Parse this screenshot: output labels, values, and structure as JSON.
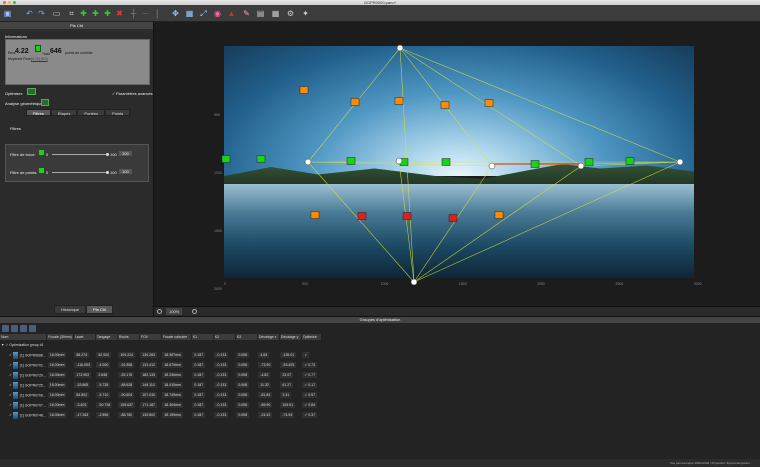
{
  "window": {
    "title": "GOPR0000.pano*"
  },
  "toolbar": {
    "icons": [
      "new-icon",
      "undo-icon",
      "redo-icon",
      "image-icon",
      "crop-icon",
      "control-points-icon",
      "add-points-icon",
      "remove-points-icon",
      "delete-icon",
      "lines-icon",
      "horizon-icon",
      "vertical-icon",
      "move-icon",
      "layout-icon",
      "fit-icon",
      "color-icon",
      "mask-icon",
      "blend-icon",
      "output-icon",
      "grid-icon",
      "settings-icon",
      "tools-icon"
    ]
  },
  "left_panel": {
    "title": "Pts Ctrl",
    "information_label": "Informations",
    "info": {
      "rms_label": "Rms:",
      "rms_value": "4.22",
      "points_count": "646",
      "points_label": "points de contrôle",
      "moyenne_label": "Moyenne Rms:",
      "links": "[4.71] [3.0]",
      "total_prefix": "Total:"
    },
    "optimiser_label": "Optimiser:",
    "advanced_label": "Paramètres avancés",
    "analyse_label": "Analyse géométrique:",
    "tabs": [
      "Filtres",
      "Étapes",
      "Portées",
      "Points"
    ],
    "filters_label": "Filtres",
    "filter_rows": [
      {
        "label": "Filtre de force:",
        "min": "0",
        "max": "100",
        "value": "100"
      },
      {
        "label": "Filtre de points:",
        "min": "0",
        "max": "100",
        "value": "100"
      }
    ],
    "bottom_tabs": [
      "Historique",
      "Pts Ctrl"
    ]
  },
  "viewport": {
    "zoom": "100%",
    "x_ticks": [
      "0",
      "500",
      "1000",
      "1500",
      "2000",
      "2500",
      "3000"
    ],
    "y_ticks": [
      "500",
      "1000",
      "1500",
      "2000"
    ]
  },
  "bottom_panel": {
    "title": "Groupes d'optimisation",
    "columns": [
      "Nom",
      "Focale (35mm)",
      "Lacet",
      "Tangage",
      "Roulis",
      "FOV",
      "Focale calculée",
      "K1",
      "K2",
      "K3",
      "Décalage x",
      "Décalage y",
      "Optimisé"
    ],
    "group_name": "Optimization group #1",
    "rows": [
      {
        "name": "[1] GOPR0688...",
        "focal": "16.00mm",
        "yaw": "86.274",
        "pitch": "62.000",
        "roll": "109.224",
        "fov": "130.283",
        "calc": "18.987mm",
        "k1": "0.187",
        "k2": "-0.133",
        "k3": "0.008",
        "dx": "4.69",
        "dy": "-135.01",
        "opt": ""
      },
      {
        "name": "[1] GOPR0702...",
        "focal": "16.00mm",
        "yaw": "-116.053",
        "pitch": "-4.000",
        "roll": "-91.558",
        "fov": "131.412",
        "calc": "18.679mm",
        "k1": "0.187",
        "k2": "-0.133",
        "k3": "0.008",
        "dx": "-73.90",
        "dy": "-53.493",
        "opt": "0.73"
      },
      {
        "name": "[1] GOPR0729...",
        "focal": "16.00mm",
        "yaw": "173.953",
        "pitch": "2.848",
        "roll": "-92.178",
        "fov": "182.133",
        "calc": "18.236mm",
        "k1": "0.187",
        "k2": "-0.133",
        "k3": "0.008",
        "dx": "-4.82",
        "dy": "23.07",
        "opt": "0.77"
      },
      {
        "name": "[1] GOPR0725...",
        "focal": "16.00mm",
        "yaw": "-33.865",
        "pitch": "-5.735",
        "roll": "-88.628",
        "fov": "149.110",
        "calc": "18.410mm",
        "k1": "0.187",
        "k2": "-0.133",
        "k3": "0.008",
        "dx": "11.32",
        "dy": "61.27",
        "opt": "0.17"
      },
      {
        "name": "[1] GOPR0706...",
        "focal": "16.00mm",
        "yaw": "84.802",
        "pitch": "-5.710",
        "roll": "-90.604",
        "fov": "107.030",
        "calc": "18.745mm",
        "k1": "0.187",
        "k2": "-0.133",
        "k3": "0.008",
        "dx": "-81.84",
        "dy": "3.31",
        "opt": "0.57"
      },
      {
        "name": "[1] GOPR0707...",
        "focal": "16.00mm",
        "yaw": "-3.403",
        "pitch": "-50.728",
        "roll": "105.637",
        "fov": "171.187",
        "calc": "18.404mm",
        "k1": "0.187",
        "k2": "-0.133",
        "k3": "0.008",
        "dx": "-89.90",
        "dy": "109.51",
        "opt": "0.84"
      },
      {
        "name": "[1] GOPR0748...",
        "focal": "16.00mm",
        "yaw": "-47.263",
        "pitch": "-2.556",
        "roll": "-88.780",
        "fov": "130.802",
        "calc": "18.159mm",
        "k1": "0.187",
        "k2": "-0.133",
        "k3": "0.008",
        "dx": "-24.42",
        "dy": "-74.94",
        "opt": "0.37"
      }
    ]
  },
  "status": {
    "text": "Vue panoramique 4096x2048 | Projection: Équirectangulaire"
  },
  "colors": {
    "good": "#1bd11b",
    "warn": "#ff8c00",
    "bad": "#e0201a",
    "link": "#d7e43a"
  }
}
